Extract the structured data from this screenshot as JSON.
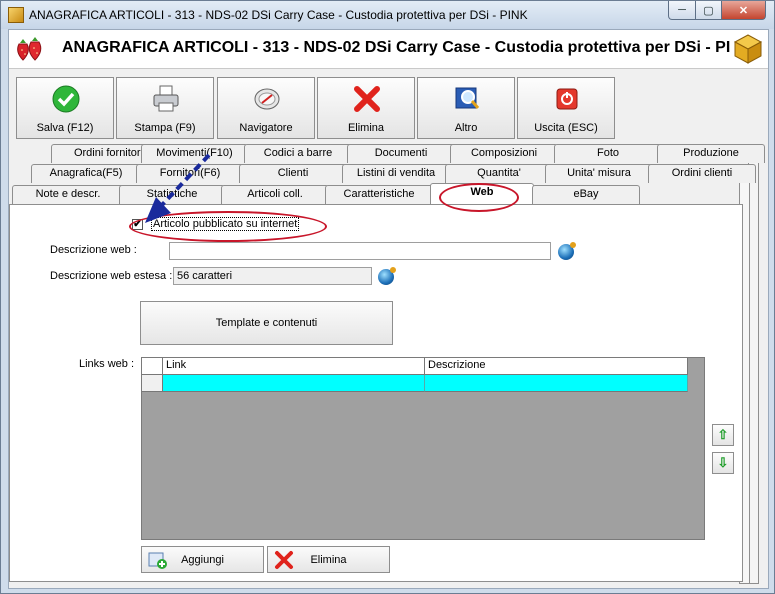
{
  "window": {
    "title": "ANAGRAFICA ARTICOLI - 313 - NDS-02 DSi Carry Case - Custodia protettiva per DSi - PINK",
    "min_glyph": "─",
    "max_glyph": "▢",
    "close_glyph": "✕"
  },
  "header": {
    "title": "ANAGRAFICA ARTICOLI - 313 - NDS-02 DSi Carry Case - Custodia protettiva per DSi - PI"
  },
  "toolbar": {
    "buttons": [
      {
        "label": "Salva (F12)",
        "icon": "check-icon"
      },
      {
        "label": "Stampa (F9)",
        "icon": "printer-icon"
      },
      {
        "label": "Navigatore",
        "icon": "compass-icon"
      },
      {
        "label": "Elimina",
        "icon": "delete-x-icon"
      },
      {
        "label": "Altro",
        "icon": "search-book-icon"
      },
      {
        "label": "Uscita (ESC)",
        "icon": "exit-icon"
      }
    ]
  },
  "tabs": {
    "row1": [
      "Ordini fornitori",
      "Movimenti(F10)",
      "Codici a barre",
      "Documenti",
      "Composizioni",
      "Foto",
      "Produzione"
    ],
    "row2": [
      "Anagrafica(F5)",
      "Fornitori(F6)",
      "Clienti",
      "Listini di vendita",
      "Quantita'",
      "Unita' misura",
      "Ordini clienti"
    ],
    "row3": [
      "Note e descr.",
      "Statistiche",
      "Articoli coll.",
      "Caratteristiche",
      "Web",
      "eBay"
    ],
    "active": "Web"
  },
  "web": {
    "published_checkbox_label": "Articolo pubblicato su internet",
    "published_checked": true,
    "check_glyph": "✔",
    "descrizione_web_label": "Descrizione web :",
    "descrizione_web_value": "",
    "descrizione_estesa_label": "Descrizione web estesa :",
    "descrizione_estesa_value": "56 caratteri",
    "template_button": "Template e contenuti",
    "links_label": "Links web :",
    "links_columns": [
      "Link",
      "Descrizione"
    ],
    "move_up_glyph": "⇧",
    "move_down_glyph": "⇩"
  },
  "bottom_buttons": {
    "add_label": "Aggiungi",
    "delete_label": "Elimina"
  },
  "colors": {
    "grid_selected_row": "#00ffff",
    "annotation_red": "#c8162a",
    "annotation_arrow": "#1a2a9c"
  }
}
